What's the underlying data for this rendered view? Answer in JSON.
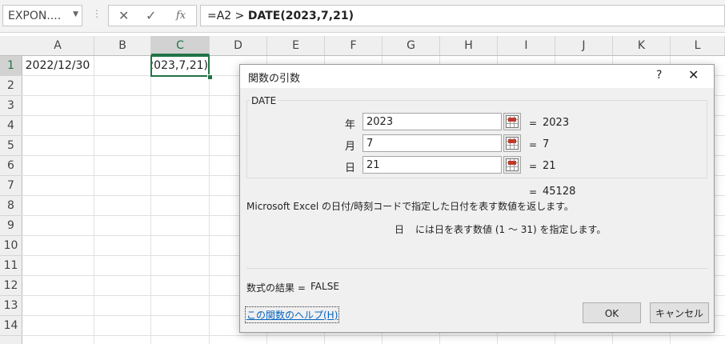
{
  "formula_bar": {
    "name_box": "EXPON....",
    "formula_prefix": "=A2 > ",
    "formula_bold": "DATE(2023,7,21)"
  },
  "columns": [
    "A",
    "B",
    "C",
    "D",
    "E",
    "F",
    "G",
    "H",
    "I",
    "J",
    "K",
    "L"
  ],
  "rows": [
    "1",
    "2",
    "3",
    "4",
    "5",
    "6",
    "7",
    "8",
    "9",
    "10",
    "11",
    "12",
    "13",
    "14"
  ],
  "cells": {
    "A1": "2022/12/30",
    "C1": "=A2 > DATE(2023,7,21)"
  },
  "dialog": {
    "title": "関数の引数",
    "help_glyph": "?",
    "close_glyph": "✕",
    "function_name": "DATE",
    "args": [
      {
        "label": "年",
        "value": "2023",
        "result": "2023"
      },
      {
        "label": "月",
        "value": "7",
        "result": "7"
      },
      {
        "label": "日",
        "value": "21",
        "result": "21"
      }
    ],
    "equals": "=",
    "function_result": "45128",
    "description": "Microsoft Excel の日付/時刻コードで指定した日付を表す数値を返します。",
    "arg_desc_name": "日",
    "arg_desc_text": "には日を表す数値 (1 ～ 31) を指定します。",
    "formula_result_label": "数式の結果 =",
    "formula_result_value": "FALSE",
    "help_link": "この関数のヘルプ(H)",
    "ok_label": "OK",
    "cancel_label": "キャンセル"
  },
  "colors": {
    "excel_green": "#217346",
    "link_blue": "#0563c1"
  }
}
